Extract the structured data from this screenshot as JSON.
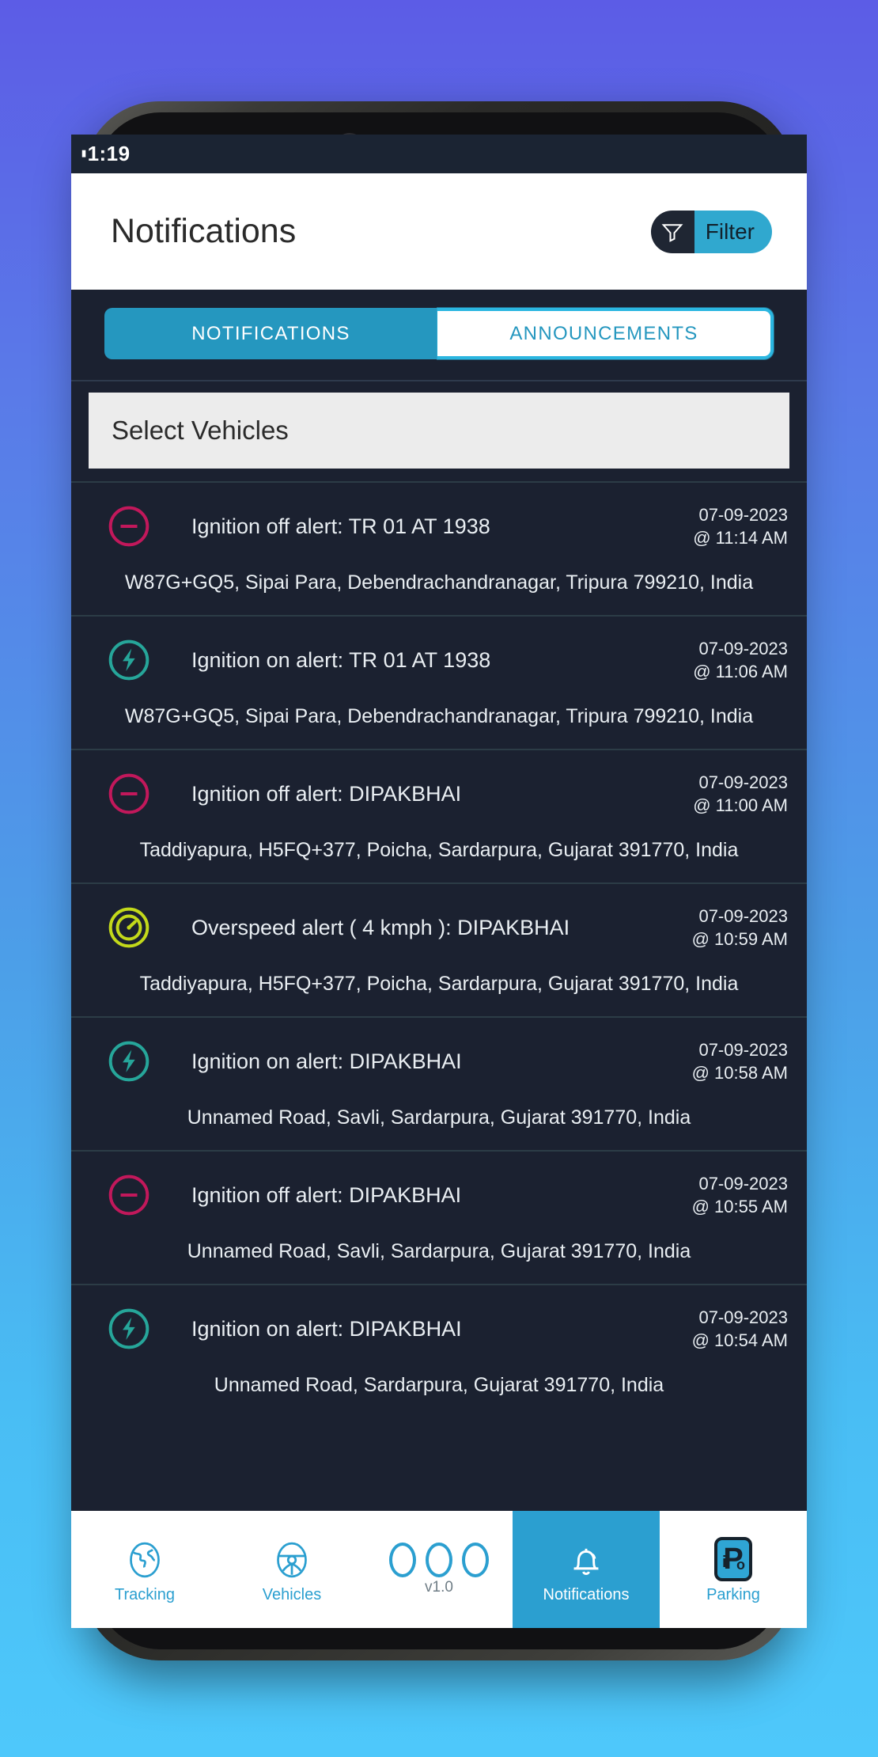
{
  "background": {
    "top_color": "#5c5ce6",
    "bottom_color": "#4ec8fb"
  },
  "status_bar": {
    "time": "1:19"
  },
  "app_bar": {
    "title": "Notifications",
    "filter_button": {
      "label": "Filter",
      "icon": "filter-funnel-icon",
      "accent": "#30a8cf"
    }
  },
  "tabs": [
    {
      "label": "NOTIFICATIONS",
      "active": true
    },
    {
      "label": "ANNOUNCEMENTS",
      "active": false
    }
  ],
  "vehicle_selector": {
    "label": "Select Vehicles"
  },
  "notifications": [
    {
      "icon": "ignition-off-icon",
      "icon_color": "#c2185b",
      "title": "Ignition off alert: TR 01 AT 1938",
      "date": "07-09-2023",
      "time": "@ 11:14 AM",
      "address": "W87G+GQ5, Sipai Para, Debendrachandranagar, Tripura 799210, India"
    },
    {
      "icon": "ignition-on-icon",
      "icon_color": "#26a69a",
      "title": "Ignition on alert: TR 01 AT 1938",
      "date": "07-09-2023",
      "time": "@ 11:06 AM",
      "address": "W87G+GQ5, Sipai Para, Debendrachandranagar, Tripura 799210, India"
    },
    {
      "icon": "ignition-off-icon",
      "icon_color": "#c2185b",
      "title": "Ignition off alert: DIPAKBHAI",
      "date": "07-09-2023",
      "time": "@ 11:00 AM",
      "address": "Taddiyapura, H5FQ+377, Poicha, Sardarpura, Gujarat 391770, India"
    },
    {
      "icon": "overspeed-icon",
      "icon_color": "#c3d91a",
      "title": "Overspeed alert ( 4 kmph ): DIPAKBHAI",
      "date": "07-09-2023",
      "time": "@ 10:59 AM",
      "address": "Taddiyapura, H5FQ+377, Poicha, Sardarpura, Gujarat 391770, India"
    },
    {
      "icon": "ignition-on-icon",
      "icon_color": "#26a69a",
      "title": "Ignition on alert: DIPAKBHAI",
      "date": "07-09-2023",
      "time": "@ 10:58 AM",
      "address": "Unnamed Road, Savli, Sardarpura, Gujarat 391770, India"
    },
    {
      "icon": "ignition-off-icon",
      "icon_color": "#c2185b",
      "title": "Ignition off alert: DIPAKBHAI",
      "date": "07-09-2023",
      "time": "@ 10:55 AM",
      "address": "Unnamed Road, Savli, Sardarpura, Gujarat 391770, India"
    },
    {
      "icon": "ignition-on-icon",
      "icon_color": "#26a69a",
      "title": "Ignition on alert: DIPAKBHAI",
      "date": "07-09-2023",
      "time": "@ 10:54 AM",
      "address": "Unnamed Road, Sardarpura, Gujarat 391770, India"
    }
  ],
  "bottom_nav": {
    "items": [
      {
        "label": "Tracking",
        "icon": "globe-icon",
        "active": false
      },
      {
        "label": "Vehicles",
        "icon": "steering-wheel-icon",
        "active": false
      },
      {
        "label": "",
        "icon": "app-logo-icon",
        "version": "v1.0",
        "active": false
      },
      {
        "label": "Notifications",
        "icon": "bell-icon",
        "active": true
      },
      {
        "label": "Parking",
        "icon": "parking-icon",
        "active": false
      }
    ],
    "accent": "#2b9fd0"
  }
}
